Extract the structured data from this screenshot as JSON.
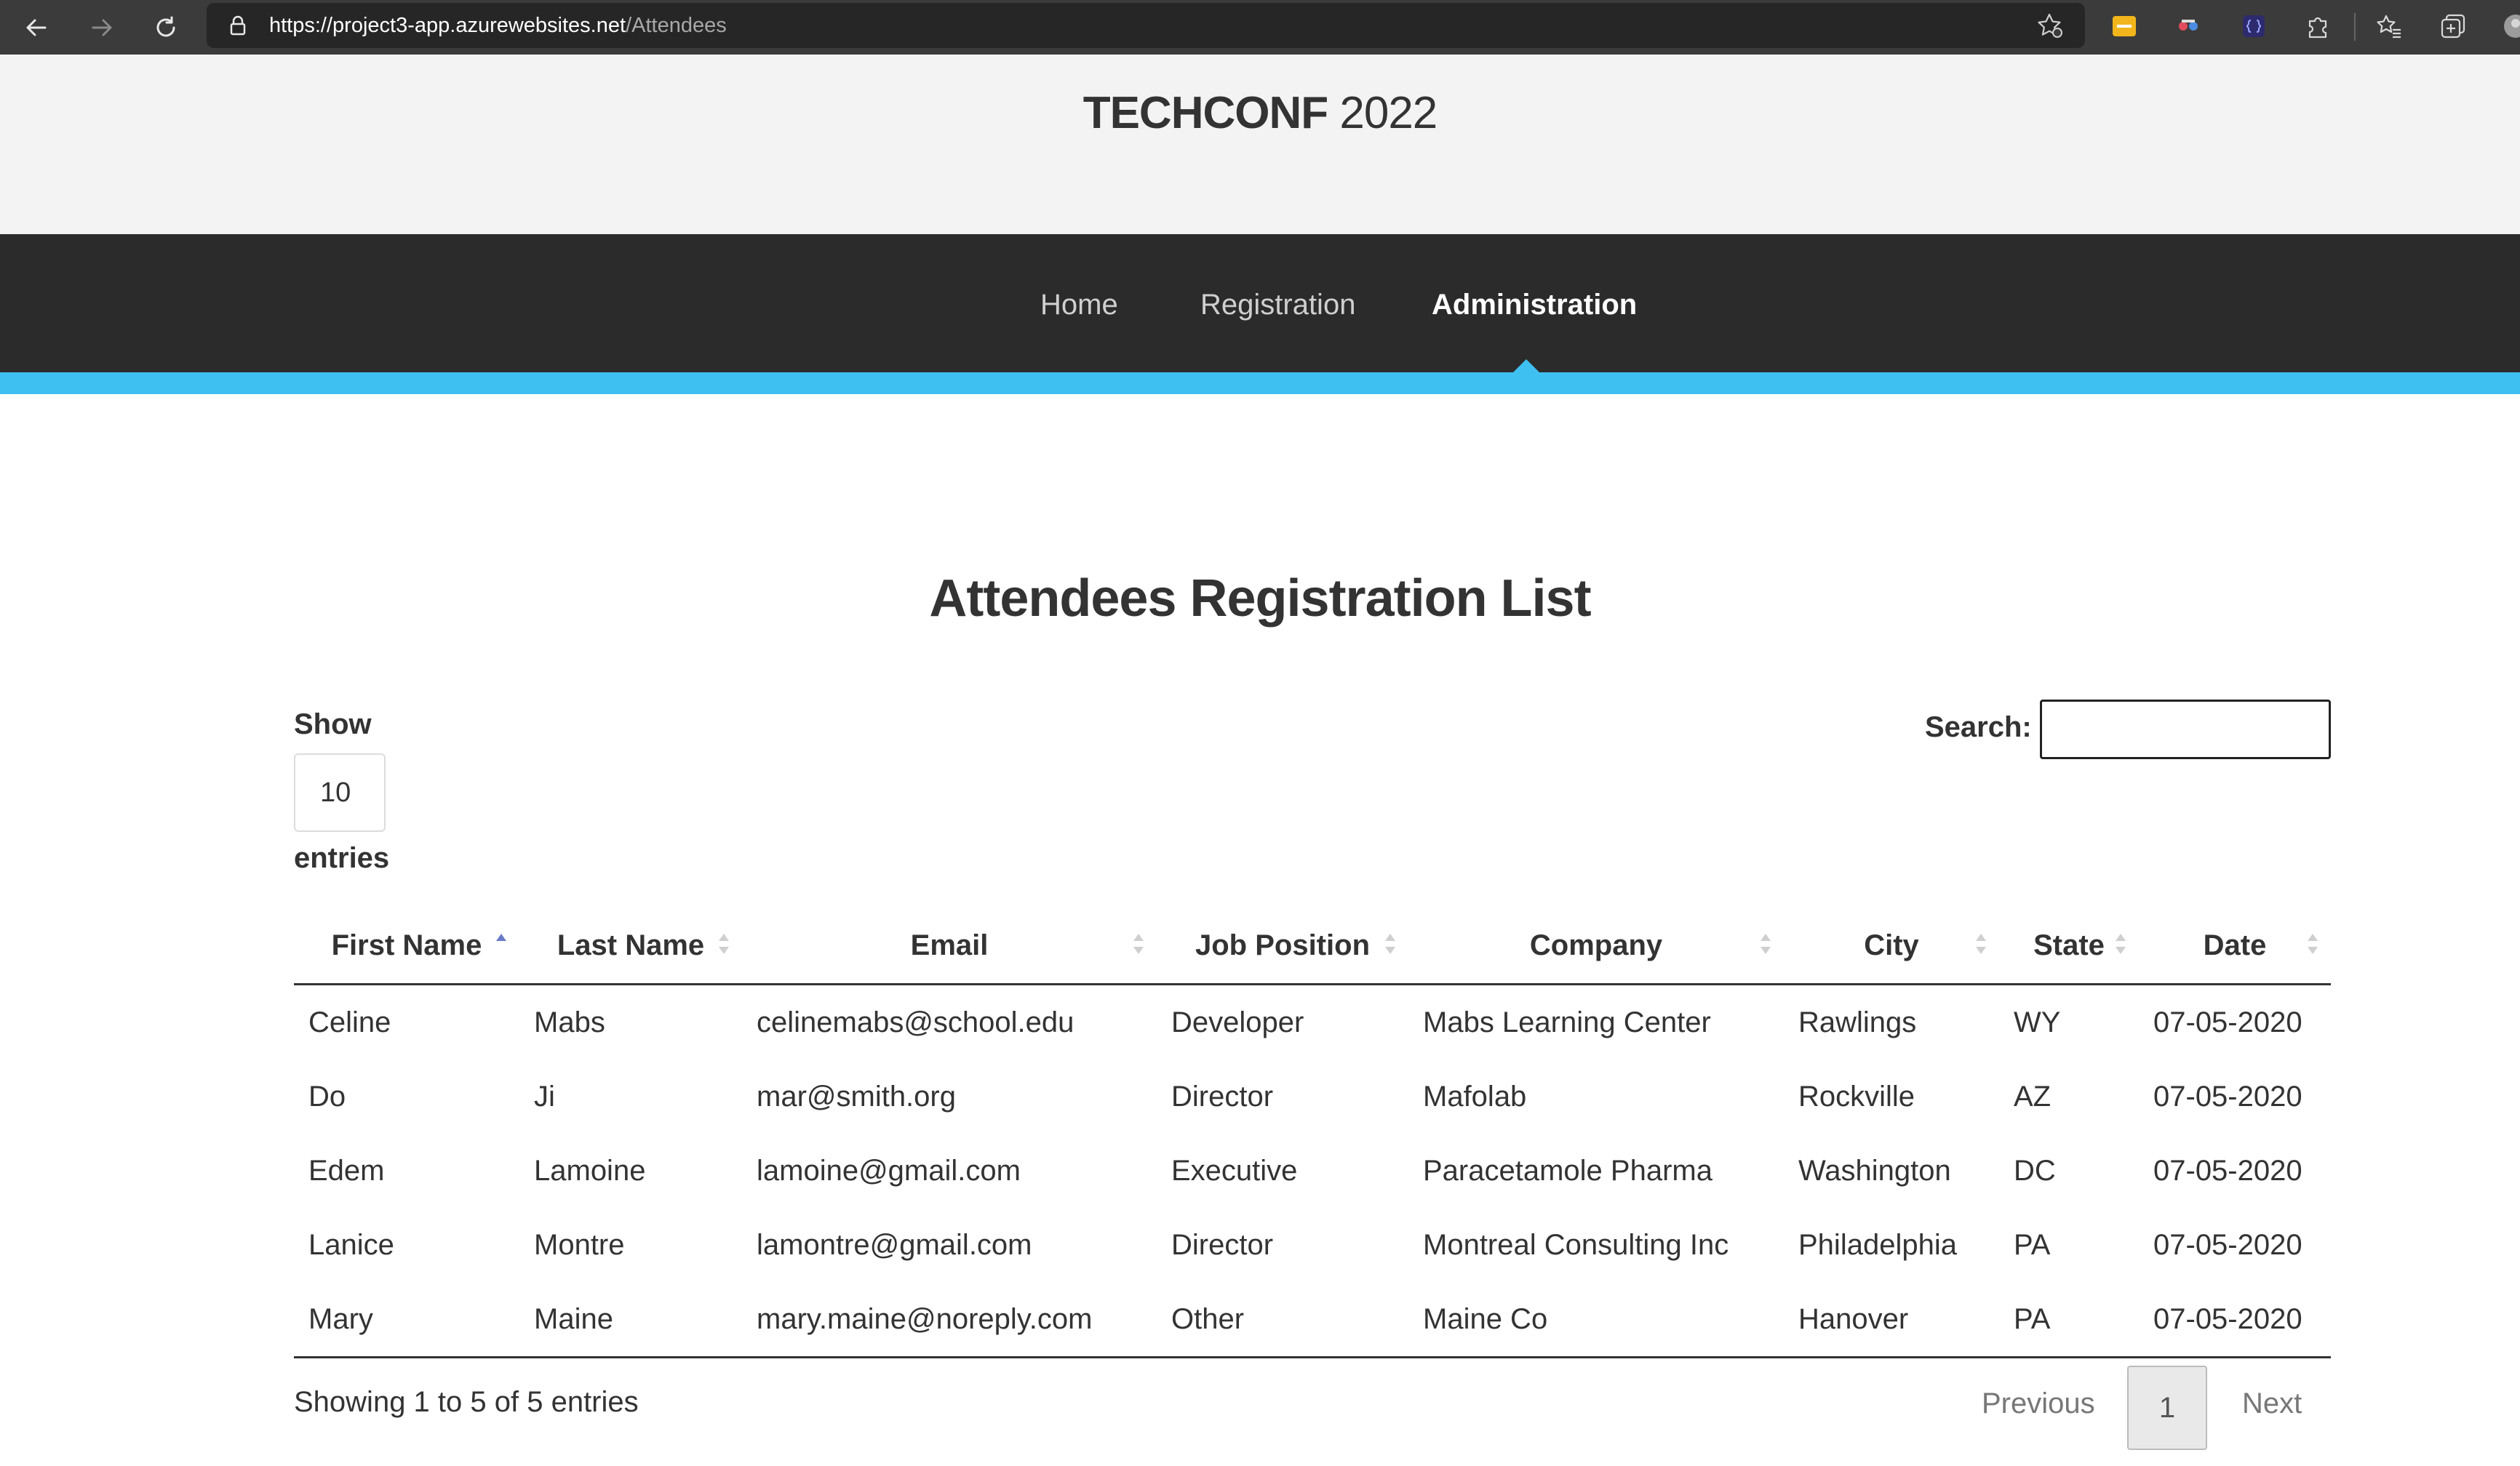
{
  "browser": {
    "url_host": "https://project3-app.azurewebsites.net",
    "url_path": "/Attendees",
    "icons": [
      "back-icon",
      "forward-icon",
      "reload-icon",
      "lock-icon",
      "favorite-add-icon",
      "extension-yellow-icon",
      "extension-mask-icon",
      "extension-brackets-icon",
      "extensions-puzzle-icon",
      "favorites-icon",
      "collections-icon",
      "profile-icon"
    ]
  },
  "site": {
    "brand_bold": "TECHCONF",
    "brand_year": "2022",
    "nav": [
      {
        "label": "Home",
        "active": false
      },
      {
        "label": "Registration",
        "active": false
      },
      {
        "label": "Administration",
        "active": true
      }
    ]
  },
  "colors": {
    "nav_bg": "#2b2b2b",
    "accent": "#3ec0f0",
    "sort_active": "#6b7bc9"
  },
  "main": {
    "title": "Attendees Registration List",
    "show_label": "Show",
    "entries_label": "entries",
    "page_length": "10",
    "search_label": "Search:",
    "search_value": "",
    "table": {
      "columns": [
        "First Name",
        "Last Name",
        "Email",
        "Job Position",
        "Company",
        "City",
        "State",
        "Date"
      ],
      "sorted_column": "First Name",
      "sort_direction": "ascending",
      "rows": [
        [
          "Celine",
          "Mabs",
          "celinemabs@school.edu",
          "Developer",
          "Mabs Learning Center",
          "Rawlings",
          "WY",
          "07-05-2020"
        ],
        [
          "Do",
          "Ji",
          "mar@smith.org",
          "Director",
          "Mafolab",
          "Rockville",
          "AZ",
          "07-05-2020"
        ],
        [
          "Edem",
          "Lamoine",
          "lamoine@gmail.com",
          "Executive",
          "Paracetamole Pharma",
          "Washington",
          "DC",
          "07-05-2020"
        ],
        [
          "Lanice",
          "Montre",
          "lamontre@gmail.com",
          "Director",
          "Montreal Consulting Inc",
          "Philadelphia",
          "PA",
          "07-05-2020"
        ],
        [
          "Mary",
          "Maine",
          "mary.maine@noreply.com",
          "Other",
          "Maine Co",
          "Hanover",
          "PA",
          "07-05-2020"
        ]
      ]
    },
    "info": "Showing 1 to 5 of 5 entries",
    "pagination": {
      "previous": "Previous",
      "current": "1",
      "next": "Next"
    }
  }
}
